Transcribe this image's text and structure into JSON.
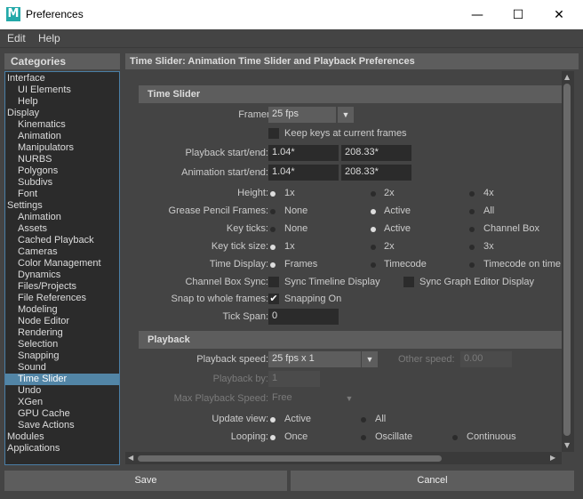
{
  "window": {
    "title": "Preferences",
    "icon_letter": "M",
    "icon_color": "#23a9a9",
    "minimize": "—",
    "maximize": "☐",
    "close": "✕"
  },
  "menubar": {
    "items": [
      "Edit",
      "Help"
    ]
  },
  "categories": {
    "header": "Categories",
    "items": [
      {
        "label": "Interface",
        "level": 0
      },
      {
        "label": "UI Elements",
        "level": 1
      },
      {
        "label": "Help",
        "level": 1
      },
      {
        "label": "Display",
        "level": 0
      },
      {
        "label": "Kinematics",
        "level": 1
      },
      {
        "label": "Animation",
        "level": 1
      },
      {
        "label": "Manipulators",
        "level": 1
      },
      {
        "label": "NURBS",
        "level": 1
      },
      {
        "label": "Polygons",
        "level": 1
      },
      {
        "label": "Subdivs",
        "level": 1
      },
      {
        "label": "Font",
        "level": 1
      },
      {
        "label": "Settings",
        "level": 0
      },
      {
        "label": "Animation",
        "level": 1
      },
      {
        "label": "Assets",
        "level": 1
      },
      {
        "label": "Cached Playback",
        "level": 1
      },
      {
        "label": "Cameras",
        "level": 1
      },
      {
        "label": "Color Management",
        "level": 1
      },
      {
        "label": "Dynamics",
        "level": 1
      },
      {
        "label": "Files/Projects",
        "level": 1
      },
      {
        "label": "File References",
        "level": 1
      },
      {
        "label": "Modeling",
        "level": 1
      },
      {
        "label": "Node Editor",
        "level": 1
      },
      {
        "label": "Rendering",
        "level": 1
      },
      {
        "label": "Selection",
        "level": 1
      },
      {
        "label": "Snapping",
        "level": 1
      },
      {
        "label": "Sound",
        "level": 1
      },
      {
        "label": "Time Slider",
        "level": 1,
        "selected": true
      },
      {
        "label": "Undo",
        "level": 1
      },
      {
        "label": "XGen",
        "level": 1
      },
      {
        "label": "GPU Cache",
        "level": 1
      },
      {
        "label": "Save Actions",
        "level": 1
      },
      {
        "label": "Modules",
        "level": 0
      },
      {
        "label": "Applications",
        "level": 0
      }
    ]
  },
  "panel": {
    "title": "Time Slider: Animation Time Slider and Playback Preferences"
  },
  "time_slider": {
    "header": "Time Slider",
    "framerate_label": "Framerate:",
    "framerate_value": "25 fps",
    "keep_keys_label": "Keep keys at current frames",
    "keep_keys_checked": false,
    "playback_range_label": "Playback start/end:",
    "playback_start": "1.04*",
    "playback_end": "208.33*",
    "animation_range_label": "Animation start/end:",
    "animation_start": "1.04*",
    "animation_end": "208.33*",
    "height_label": "Height:",
    "height_options": [
      "1x",
      "2x",
      "4x"
    ],
    "height_selected": "1x",
    "grease_label": "Grease Pencil Frames:",
    "grease_options": [
      "None",
      "Active",
      "All"
    ],
    "grease_selected": "Active",
    "key_ticks_label": "Key ticks:",
    "key_ticks_options": [
      "None",
      "Active",
      "Channel Box"
    ],
    "key_ticks_selected": "Active",
    "key_tick_size_label": "Key tick size:",
    "key_tick_size_options": [
      "1x",
      "2x",
      "3x"
    ],
    "key_tick_size_selected": "1x",
    "time_display_label": "Time Display:",
    "time_display_options": [
      "Frames",
      "Timecode",
      "Timecode on time"
    ],
    "time_display_selected": "Frames",
    "channel_box_sync_label": "Channel Box Sync:",
    "sync_timeline_label": "Sync Timeline Display",
    "sync_timeline_checked": false,
    "sync_graph_label": "Sync Graph Editor Display",
    "sync_graph_checked": false,
    "snap_label": "Snap to whole frames:",
    "snapping_on_label": "Snapping On",
    "snapping_checked": true,
    "tick_span_label": "Tick Span:",
    "tick_span_value": "0"
  },
  "playback": {
    "header": "Playback",
    "speed_label": "Playback speed:",
    "speed_value": "25 fps x 1",
    "other_speed_label": "Other speed:",
    "other_speed_value": "0.00",
    "playback_by_label": "Playback by:",
    "playback_by_value": "1",
    "max_speed_label": "Max Playback Speed:",
    "max_speed_value": "Free",
    "update_view_label": "Update view:",
    "update_view_options": [
      "Active",
      "All"
    ],
    "update_view_selected": "Active",
    "looping_label": "Looping:",
    "looping_options": [
      "Once",
      "Oscillate",
      "Continuous"
    ],
    "looping_selected": "Once"
  },
  "buttons": {
    "save": "Save",
    "cancel": "Cancel"
  }
}
